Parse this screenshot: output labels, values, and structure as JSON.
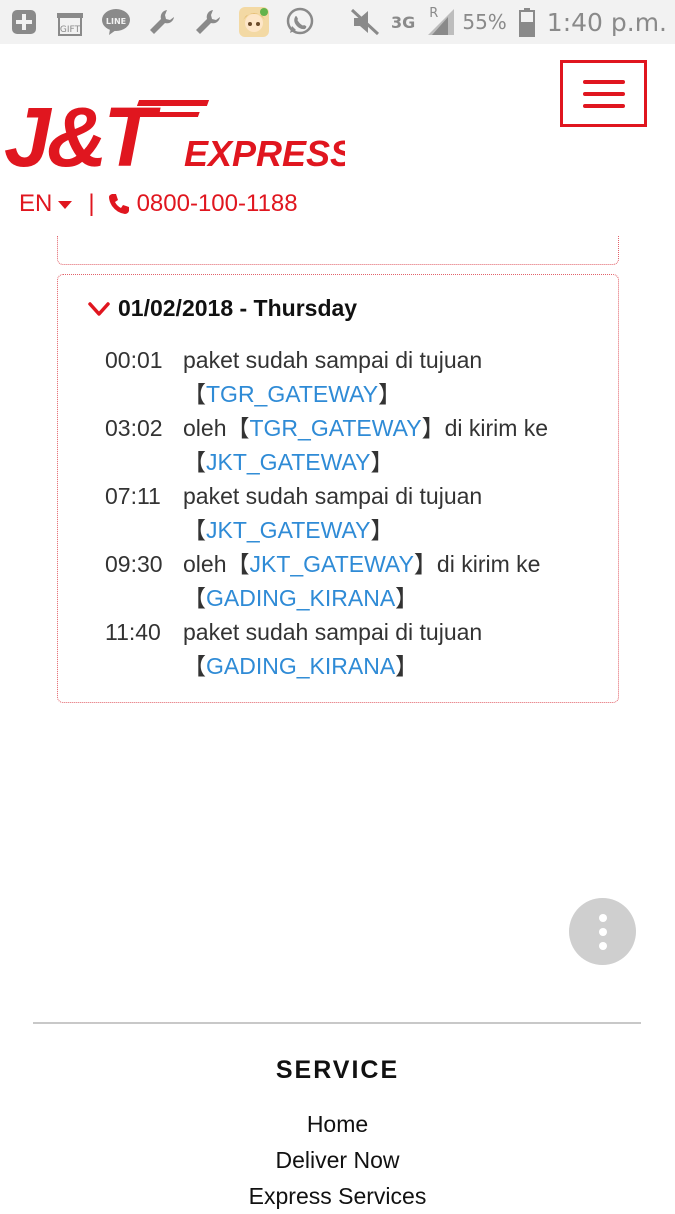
{
  "status_bar": {
    "network": "3G",
    "roaming": "R",
    "battery": "55%",
    "time": "1:40 p.m.",
    "gift_label": "GIFT",
    "line_label": "LINE",
    "icons": [
      "add-icon",
      "gift-icon",
      "line-icon",
      "wrench-icon",
      "wrench-icon",
      "game-avatar-icon",
      "whatsapp-icon",
      "mute-icon",
      "signal-icon",
      "battery-icon"
    ]
  },
  "header": {
    "logo_text": "J&T",
    "logo_express": "EXPRESS",
    "language": "EN",
    "separator": "|",
    "phone": "0800-100-1188",
    "brand_color": "#e0161f"
  },
  "tracking": {
    "day": "01/02/2018 - Thursday",
    "events": [
      {
        "time": "00:01",
        "pre": "paket sudah sampai di tujuan【",
        "loc1": "TGR_GATEWAY",
        "mid": "】",
        "loc2": "",
        "post": ""
      },
      {
        "time": "03:02",
        "pre": "oleh【",
        "loc1": "TGR_GATEWAY",
        "mid": "】di kirim ke【",
        "loc2": "JKT_GATEWAY",
        "post": "】"
      },
      {
        "time": "07:11",
        "pre": "paket sudah sampai di tujuan【",
        "loc1": "JKT_GATEWAY",
        "mid": "】",
        "loc2": "",
        "post": ""
      },
      {
        "time": "09:30",
        "pre": "oleh【",
        "loc1": "JKT_GATEWAY",
        "mid": "】di kirim ke【",
        "loc2": "GADING_KIRANA",
        "post": "】"
      },
      {
        "time": "11:40",
        "pre": "paket sudah sampai di tujuan【",
        "loc1": "GADING_KIRANA",
        "mid": "】",
        "loc2": "",
        "post": ""
      }
    ],
    "link_color": "#2f8bd6"
  },
  "footer": {
    "title": "SERVICE",
    "links": [
      "Home",
      "Deliver Now",
      "Express Services"
    ]
  }
}
